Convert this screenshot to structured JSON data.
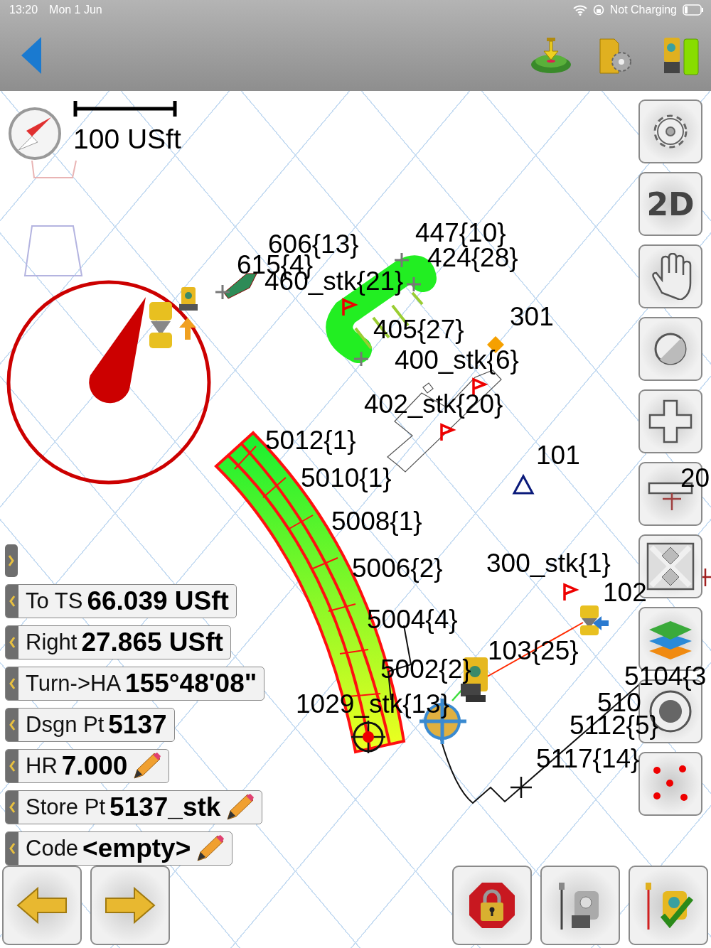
{
  "status_bar": {
    "time": "13:20",
    "date": "Mon 1 Jun",
    "charging": "Not Charging"
  },
  "scale": {
    "label": "100 USft"
  },
  "map_labels": [
    "606{13}",
    "447{10}",
    "424{28}",
    "615{4}",
    "460_stk{21}",
    "301",
    "405{27}",
    "400_stk{6}",
    "402_stk{20}",
    "5012{1}",
    "101",
    "5010{1}",
    "5008{1}",
    "5006{2}",
    "300_stk{1}",
    "102",
    "5004{4}",
    "103{25}",
    "5002{2}",
    "1029_stk{13}",
    "5104{3",
    "510",
    "5112{5}",
    "5117{14}",
    "20"
  ],
  "toolbar": {
    "view_mode": "2D"
  },
  "info_rows": [
    {
      "label": "To TS",
      "value": "66.039 USft",
      "editable": false
    },
    {
      "label": "Right",
      "value": "27.865 USft",
      "editable": false
    },
    {
      "label": "Turn->HA",
      "value": "155°48'08\"",
      "editable": false
    },
    {
      "label": "Dsgn Pt",
      "value": "5137",
      "editable": false
    },
    {
      "label": "HR",
      "value": "7.000",
      "editable": true
    },
    {
      "label": "Store Pt",
      "value": "5137_stk",
      "editable": true
    },
    {
      "label": "Code",
      "value": "<empty>",
      "editable": true
    }
  ]
}
